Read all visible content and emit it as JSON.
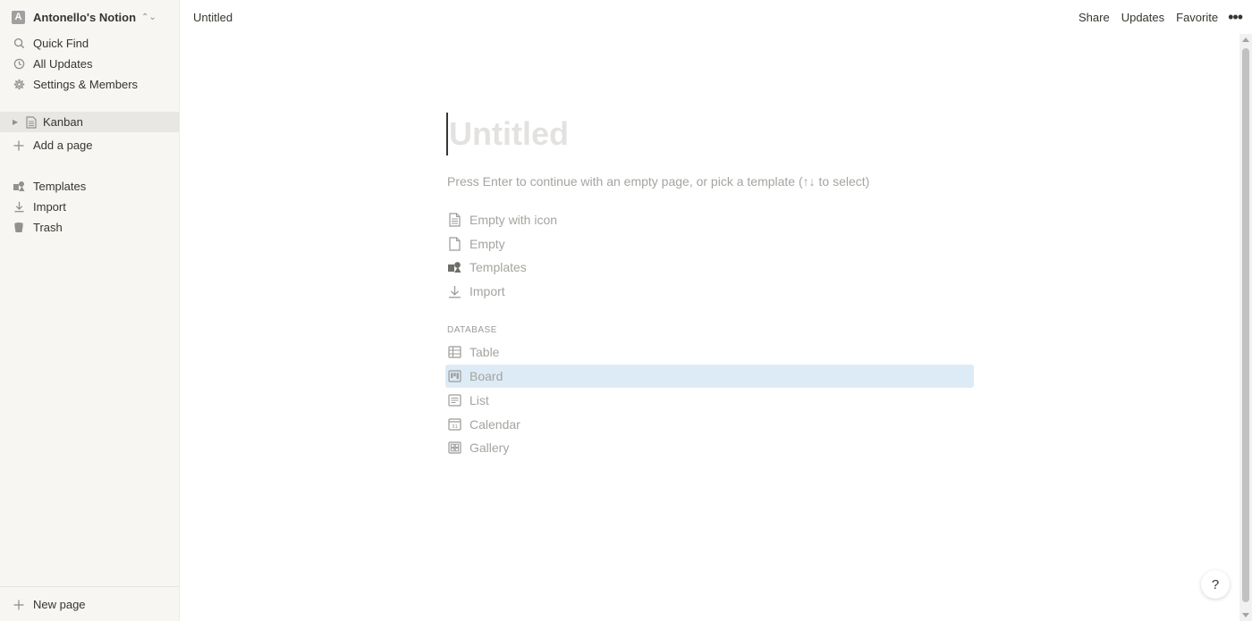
{
  "workspace": {
    "avatar_letter": "A",
    "name": "Antonello's Notion"
  },
  "sidebar": {
    "top_items": [
      {
        "label": "Quick Find",
        "icon": "search-icon"
      },
      {
        "label": "All Updates",
        "icon": "clock-icon"
      },
      {
        "label": "Settings & Members",
        "icon": "gear-icon"
      }
    ],
    "pages": [
      {
        "label": "Kanban",
        "icon": "page-icon"
      }
    ],
    "add_page": "Add a page",
    "bottom_items": [
      {
        "label": "Templates",
        "icon": "templates-icon"
      },
      {
        "label": "Import",
        "icon": "import-icon"
      },
      {
        "label": "Trash",
        "icon": "trash-icon"
      }
    ],
    "new_page": "New page"
  },
  "topbar": {
    "breadcrumb": "Untitled",
    "share": "Share",
    "updates": "Updates",
    "favorite": "Favorite"
  },
  "page": {
    "title_placeholder": "Untitled",
    "hint": "Press Enter to continue with an empty page, or pick a template (↑↓ to select)",
    "options": [
      {
        "label": "Empty with icon",
        "icon": "page-with-icon-icon"
      },
      {
        "label": "Empty",
        "icon": "blank-page-icon"
      },
      {
        "label": "Templates",
        "icon": "templates-icon"
      },
      {
        "label": "Import",
        "icon": "import-icon"
      }
    ],
    "database_label": "DATABASE",
    "database_options": [
      {
        "label": "Table",
        "icon": "table-icon",
        "selected": false
      },
      {
        "label": "Board",
        "icon": "board-icon",
        "selected": true
      },
      {
        "label": "List",
        "icon": "list-icon",
        "selected": false
      },
      {
        "label": "Calendar",
        "icon": "calendar-icon",
        "selected": false
      },
      {
        "label": "Gallery",
        "icon": "gallery-icon",
        "selected": false
      }
    ]
  },
  "help": {
    "label": "?"
  },
  "colors": {
    "sidebar_bg": "#f7f6f3",
    "selection": "#ddebf6",
    "text": "#37352f",
    "muted": "#a5a49f"
  }
}
